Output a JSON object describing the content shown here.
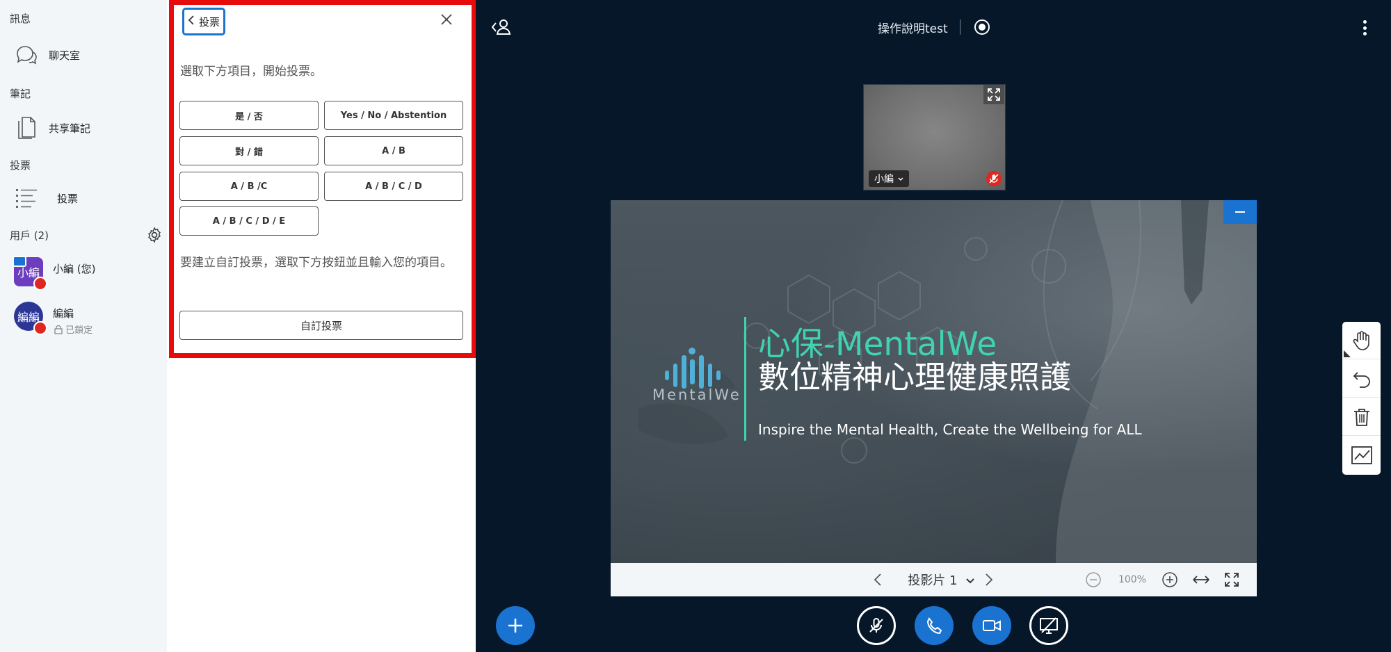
{
  "sidebar": {
    "sections": {
      "messages": "訊息",
      "notes": "筆記",
      "polling": "投票",
      "users": "用戶 (2)"
    },
    "items": {
      "chat": "聊天室",
      "shared_notes": "共享筆記",
      "poll": "投票"
    },
    "users": [
      {
        "avatar": "小編",
        "name": "小編 (您)",
        "status": ""
      },
      {
        "avatar": "編編",
        "name": "編編",
        "status": "已鎖定"
      }
    ]
  },
  "poll": {
    "back_label": "投票",
    "instruction": "選取下方項目，開始投票。",
    "options": [
      "是 / 否",
      "Yes / No / Abstention",
      "對 / 錯",
      "A / B",
      "A / B /C",
      "A / B / C / D",
      "A / B / C / D / E"
    ],
    "custom_hint": "要建立自訂投票，選取下方按鈕並且輸入您的項目。",
    "custom_button": "自訂投票"
  },
  "topbar": {
    "title": "操作說明test"
  },
  "webcam": {
    "name": "小編"
  },
  "slide": {
    "logo_text": "MentalWe",
    "headline": "心保-MentalWe",
    "subheadline": "數位精神心理健康照護",
    "tagline": "Inspire the Mental Health, Create the Wellbeing for ALL"
  },
  "slide_toolbar": {
    "slide_label": "投影片 1",
    "zoom": "100%"
  },
  "colors": {
    "accent": "#1b73d1",
    "highlight_frame": "#e80b0b",
    "muted_badge": "#df2721",
    "slide_teal": "#3fd3b1",
    "stage_bg": "#06172a"
  }
}
